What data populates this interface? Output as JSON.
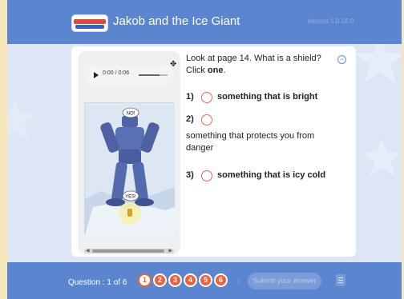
{
  "app": {
    "title": "Jakob and the Ice Giant",
    "version": "Version 1.0.18.0",
    "logo_icon": "reading-program-logo"
  },
  "player": {
    "time": "0:00 / 0:06",
    "play_icon": "play-icon",
    "expand_icon": "expand-icon"
  },
  "illustration": {
    "bubble_top": "NO!",
    "bubble_bottom": "YES!"
  },
  "question": {
    "text": "Look at page 14. What is a shield? Click",
    "emphasis": "one",
    "end": "."
  },
  "options": [
    {
      "num": "1)",
      "text": "something that is bright"
    },
    {
      "num": "2)",
      "text": "something that protects you from danger"
    },
    {
      "num": "3)",
      "text": "something that is icy cold"
    }
  ],
  "footer": {
    "question_count": "Question : 1 of 6",
    "question_buttons": [
      "1",
      "2",
      "3",
      "4",
      "5",
      "6"
    ],
    "submit_label": "Submit your answer"
  },
  "colors": {
    "header": "#5b86cf",
    "background": "#dde6f5",
    "accent": "#e9633d",
    "side": "#f5e5b8"
  }
}
